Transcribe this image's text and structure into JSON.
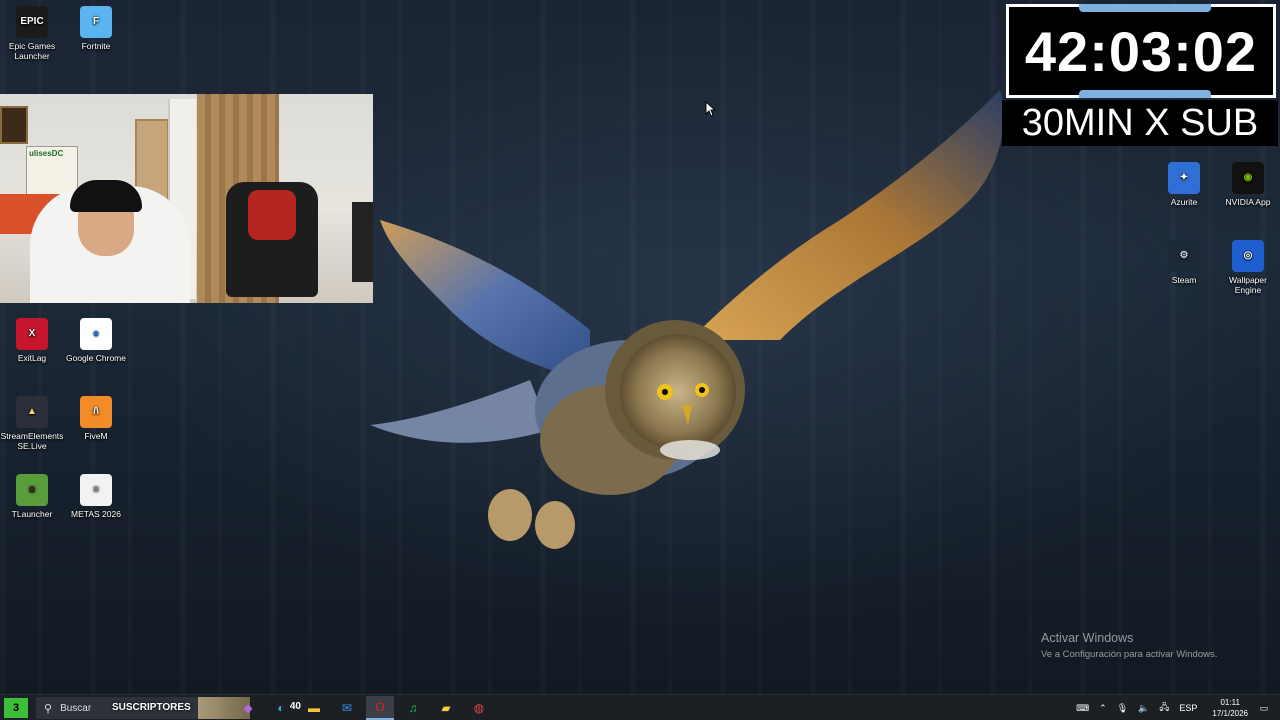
{
  "desktop": {
    "icons_left": [
      {
        "label": "Epic Games Launcher",
        "icon": "epic-games-icon",
        "glyph": "EPIC",
        "bg": "#1b1b1b",
        "fg": "#ffffff"
      },
      {
        "label": "Fortnite",
        "icon": "fortnite-icon",
        "glyph": "F",
        "bg": "#5ab4f0",
        "fg": "#ffffff"
      },
      {
        "label": "ExitLag",
        "icon": "exitlag-icon",
        "glyph": "X",
        "bg": "#c6162b",
        "fg": "#ffffff"
      },
      {
        "label": "Google Chrome",
        "icon": "chrome-icon",
        "glyph": "●",
        "bg": "#ffffff",
        "fg": "#1a73e8"
      },
      {
        "label": "StreamElements SE.Live",
        "icon": "streamelements-icon",
        "glyph": "▲",
        "bg": "#2a2f3a",
        "fg": "#ffd36a"
      },
      {
        "label": "FiveM",
        "icon": "fivem-icon",
        "glyph": "/\\",
        "bg": "#f28c28",
        "fg": "#ffffff"
      },
      {
        "label": "TLauncher",
        "icon": "tlauncher-icon",
        "glyph": "■",
        "bg": "#5a9c3a",
        "fg": "#3e2a16"
      },
      {
        "label": "METAS 2026",
        "icon": "text-document-icon",
        "glyph": "≡",
        "bg": "#f2f2f2",
        "fg": "#9a9a9a"
      }
    ],
    "icons_right": [
      {
        "label": "Azurite",
        "icon": "azurite-icon",
        "glyph": "✦",
        "bg": "#2f6fd6",
        "fg": "#ffffff"
      },
      {
        "label": "NVIDIA App",
        "icon": "nvidia-icon",
        "glyph": "◉",
        "bg": "#111111",
        "fg": "#76b900"
      },
      {
        "label": "Steam",
        "icon": "steam-icon",
        "glyph": "⚙",
        "bg": "#1b2838",
        "fg": "#c7d5e0"
      },
      {
        "label": "Wallpaper Engine",
        "icon": "wallpaper-engine-icon",
        "glyph": "◎",
        "bg": "#1e5fd0",
        "fg": "#ffffff"
      }
    ]
  },
  "webcam": {
    "poster_text": "ulisesDC"
  },
  "overlay": {
    "timer": "42:03:02",
    "subtitle": "30MIN X SUB"
  },
  "watermark": {
    "title": "Activar Windows",
    "subtitle": "Ve a Configuración para activar Windows."
  },
  "taskbar": {
    "start_badge": "3",
    "search_placeholder": "Buscar",
    "search_overlay_text": "SUSCRIPTORES",
    "apps": [
      {
        "icon": "copilot-icon",
        "glyph": "◆",
        "color": "#b06ad8"
      },
      {
        "icon": "edge-icon",
        "glyph": "◐",
        "color": "#2fa6d8",
        "badge": "40"
      },
      {
        "icon": "file-explorer-icon",
        "glyph": "▬",
        "color": "#f2c53d"
      },
      {
        "icon": "mail-icon",
        "glyph": "✉",
        "color": "#3b8ee8"
      },
      {
        "icon": "opera-icon",
        "glyph": "O",
        "color": "#e0202e",
        "active": true
      },
      {
        "icon": "spotify-icon",
        "glyph": "♫",
        "color": "#1db954"
      },
      {
        "icon": "sticky-notes-icon",
        "glyph": "▰",
        "color": "#f5d142"
      },
      {
        "icon": "obs-icon",
        "glyph": "◍",
        "color": "#e04646"
      }
    ],
    "tray": {
      "language": "ESP",
      "time": "01:11",
      "date": "17/1/2026"
    }
  }
}
